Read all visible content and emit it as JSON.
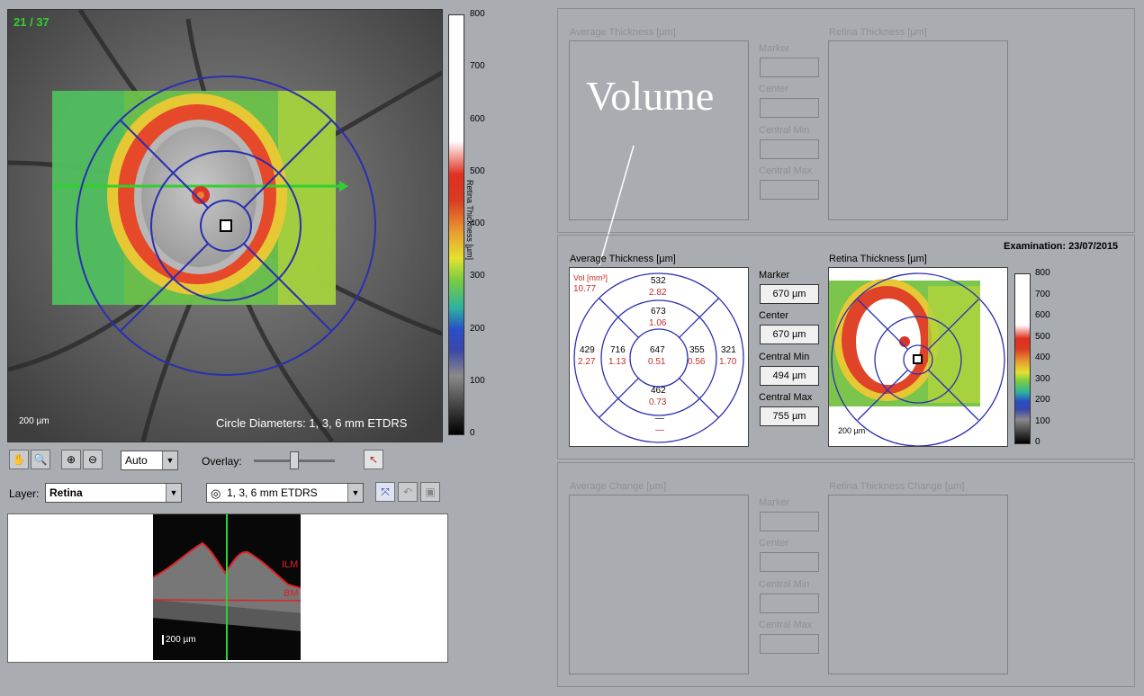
{
  "fundus": {
    "slice_counter": "21 / 37",
    "scalebar": "200 µm",
    "circle_caption": "Circle Diameters: 1, 3, 6 mm ETDRS"
  },
  "color_scale": {
    "title": "Retina Thickness [µm]",
    "ticks": [
      "800",
      "700",
      "600",
      "500",
      "400",
      "300",
      "200",
      "100",
      "0"
    ]
  },
  "toolbar": {
    "zoom_mode": "Auto",
    "overlay_label": "Overlay:",
    "overlay_level": 0.5,
    "layer_label": "Layer:",
    "layer_value": "Retina",
    "grid_value": "1, 3, 6 mm ETDRS"
  },
  "bscan": {
    "label_ilm": "ILM",
    "label_bm": "BM",
    "scalebar": "200 µm"
  },
  "annotation": {
    "text": "Volume"
  },
  "top_section": {
    "avg_label": "Average Thickness [µm]",
    "retina_label": "Retina Thickness [µm]",
    "marker_label": "Marker",
    "center_label": "Center",
    "central_min_label": "Central Min",
    "central_max_label": "Central Max"
  },
  "middle_section": {
    "examination": "Examination: 23/07/2015",
    "avg_label": "Average Thickness [µm]",
    "retina_label": "Retina Thickness [µm]",
    "marker_label": "Marker",
    "marker_value": "670 µm",
    "center_label": "Center",
    "center_value": "670 µm",
    "central_min_label": "Central Min",
    "central_min_value": "494 µm",
    "central_max_label": "Central Max",
    "central_max_value": "755 µm",
    "mini_scalebar": "200 µm",
    "mini_scale_ticks": [
      "800",
      "700",
      "600",
      "500",
      "400",
      "300",
      "200",
      "100",
      "0"
    ],
    "etdrs": {
      "vol_label": "Vol [mm³]",
      "vol_value": "10.77",
      "superior_outer": {
        "thickness": "532",
        "volume": "2.82"
      },
      "superior_inner": {
        "thickness": "673",
        "volume": "1.06"
      },
      "temporal_outer": {
        "thickness": "429",
        "volume": "2.27"
      },
      "temporal_inner": {
        "thickness": "716",
        "volume": "1.13"
      },
      "center": {
        "thickness": "647",
        "volume": "0.51"
      },
      "nasal_inner": {
        "thickness": "355",
        "volume": "0.56"
      },
      "nasal_outer": {
        "thickness": "321",
        "volume": "1.70"
      },
      "inferior_inner": {
        "thickness": "462",
        "volume": "0.73"
      },
      "inferior_outer": {
        "thickness": "—",
        "volume": "—"
      }
    }
  },
  "bottom_section": {
    "avg_label": "Average Change [µm]",
    "retina_label": "Retina Thickness Change [µm]",
    "marker_label": "Marker",
    "center_label": "Center",
    "central_min_label": "Central Min",
    "central_max_label": "Central Max"
  },
  "colors": {
    "etdrs_grid": "#2b2fb0",
    "volume_text": "#c0302a",
    "slice_counter": "#2fd12f",
    "scan_line": "#2fd12f"
  }
}
